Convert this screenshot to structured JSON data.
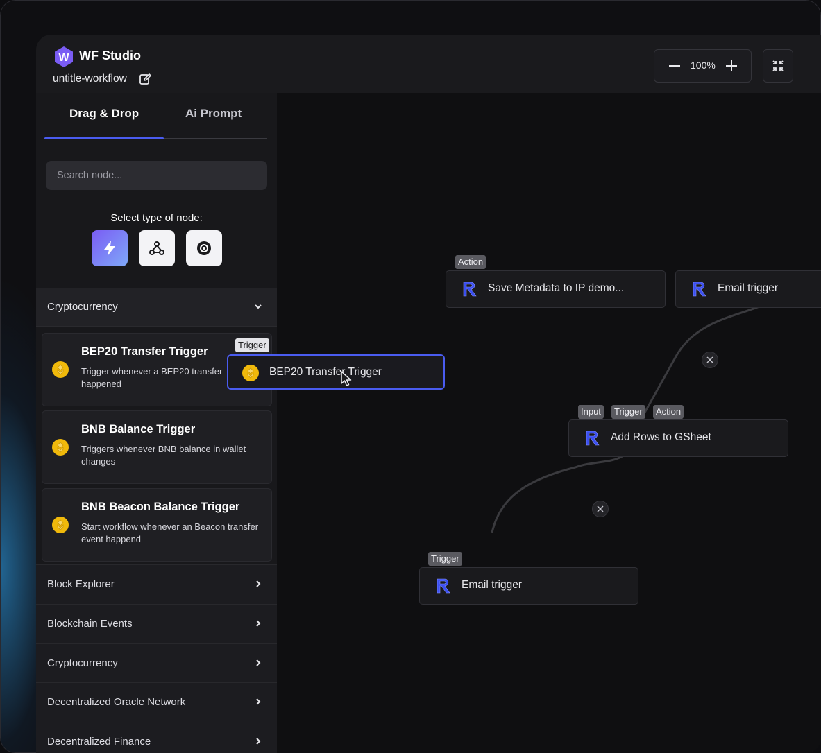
{
  "app": {
    "brand": "WF Studio",
    "logo_letter": "W",
    "workflow_name": "untitle-workflow"
  },
  "toolbar": {
    "zoom_level": "100%",
    "icons": [
      "minus-icon",
      "plus-icon",
      "fit-screen-icon"
    ]
  },
  "sidebar": {
    "tabs": [
      {
        "label": "Drag & Drop",
        "active": true
      },
      {
        "label": "Ai Prompt",
        "active": false
      }
    ],
    "search": {
      "placeholder": "Search node...",
      "value": ""
    },
    "select_type_label": "Select type of node:",
    "node_types": [
      "lightning-icon",
      "webhook-icon",
      "gear-icon"
    ],
    "open_category": {
      "label": "Cryptocurrency",
      "items": [
        {
          "title": "BEP20 Transfer Trigger",
          "desc": "Trigger whenever a BEP20 transfer happened"
        },
        {
          "title": "BNB Balance Trigger",
          "desc": "Triggers whenever BNB balance in wallet changes"
        },
        {
          "title": "BNB Beacon Balance Trigger",
          "desc": "Start workflow whenever an Beacon transfer event happend"
        }
      ]
    },
    "categories": [
      "Block Explorer",
      "Blockchain Events",
      "Cryptocurrency",
      "Decentralized Oracle Network",
      "Decentralized Finance"
    ]
  },
  "canvas": {
    "dragging": {
      "tag": "Trigger",
      "label": "BEP20 Transfer Trigger"
    },
    "nodes": [
      {
        "label": "Save Metadata to IP demo...",
        "tags": [
          "Action"
        ]
      },
      {
        "label": "Email trigger",
        "tags": []
      },
      {
        "label": "Add Rows to GSheet",
        "tags": [
          "Input",
          "Trigger",
          "Action"
        ]
      },
      {
        "label": "Email trigger",
        "tags": [
          "Trigger"
        ]
      }
    ]
  },
  "colors": {
    "accent": "#4a5cf0",
    "coin": "#f0b90b",
    "node_logo": "#3b4ff0"
  }
}
